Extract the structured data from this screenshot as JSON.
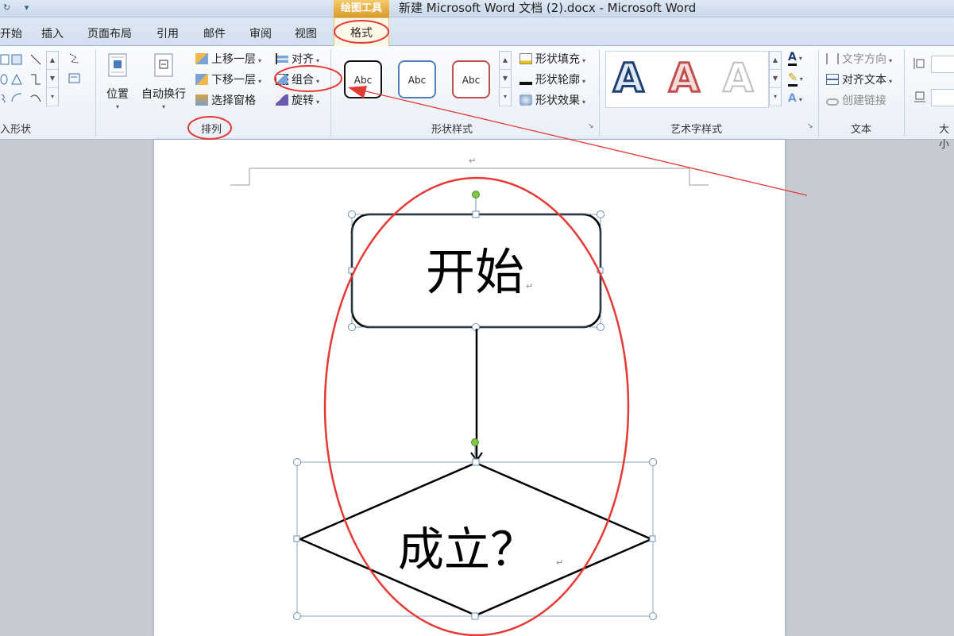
{
  "title_bar": {
    "contextual_tab_group": "绘图工具",
    "document_title": "新建 Microsoft Word 文档 (2).docx - Microsoft Word"
  },
  "tabs": [
    {
      "label": "开始"
    },
    {
      "label": "插入"
    },
    {
      "label": "页面布局"
    },
    {
      "label": "引用"
    },
    {
      "label": "邮件"
    },
    {
      "label": "审阅"
    },
    {
      "label": "视图"
    },
    {
      "label": "格式",
      "active": true
    }
  ],
  "ribbon": {
    "insert_shapes": {
      "label": "入形状"
    },
    "arrange": {
      "label": "排列",
      "position": "位置",
      "wrap_text": "自动换行",
      "bring_forward": "上移一层",
      "send_backward": "下移一层",
      "selection_pane": "选择窗格",
      "align": "对齐",
      "group": "组合",
      "rotate": "旋转"
    },
    "shape_styles": {
      "label": "形状样式",
      "presets": [
        "Abc",
        "Abc",
        "Abc"
      ],
      "fill": "形状填充",
      "outline": "形状轮廓",
      "effects": "形状效果"
    },
    "wordart_styles": {
      "label": "艺术字样式",
      "samples": [
        "A",
        "A",
        "A"
      ]
    },
    "text": {
      "label": "文本",
      "text_direction": "文字方向",
      "align_text": "对齐文本",
      "create_link": "创建链接"
    },
    "size": {
      "label": "大小"
    }
  },
  "document": {
    "paragraph_mark": "↵",
    "shape_start": "开始",
    "shape_decision": "成立？"
  },
  "colors": {
    "annotation_red": "#e53935",
    "handle_green": "#7ec843",
    "selection_blue": "#6f8faf",
    "contextual_orange": "#e1a53a"
  }
}
